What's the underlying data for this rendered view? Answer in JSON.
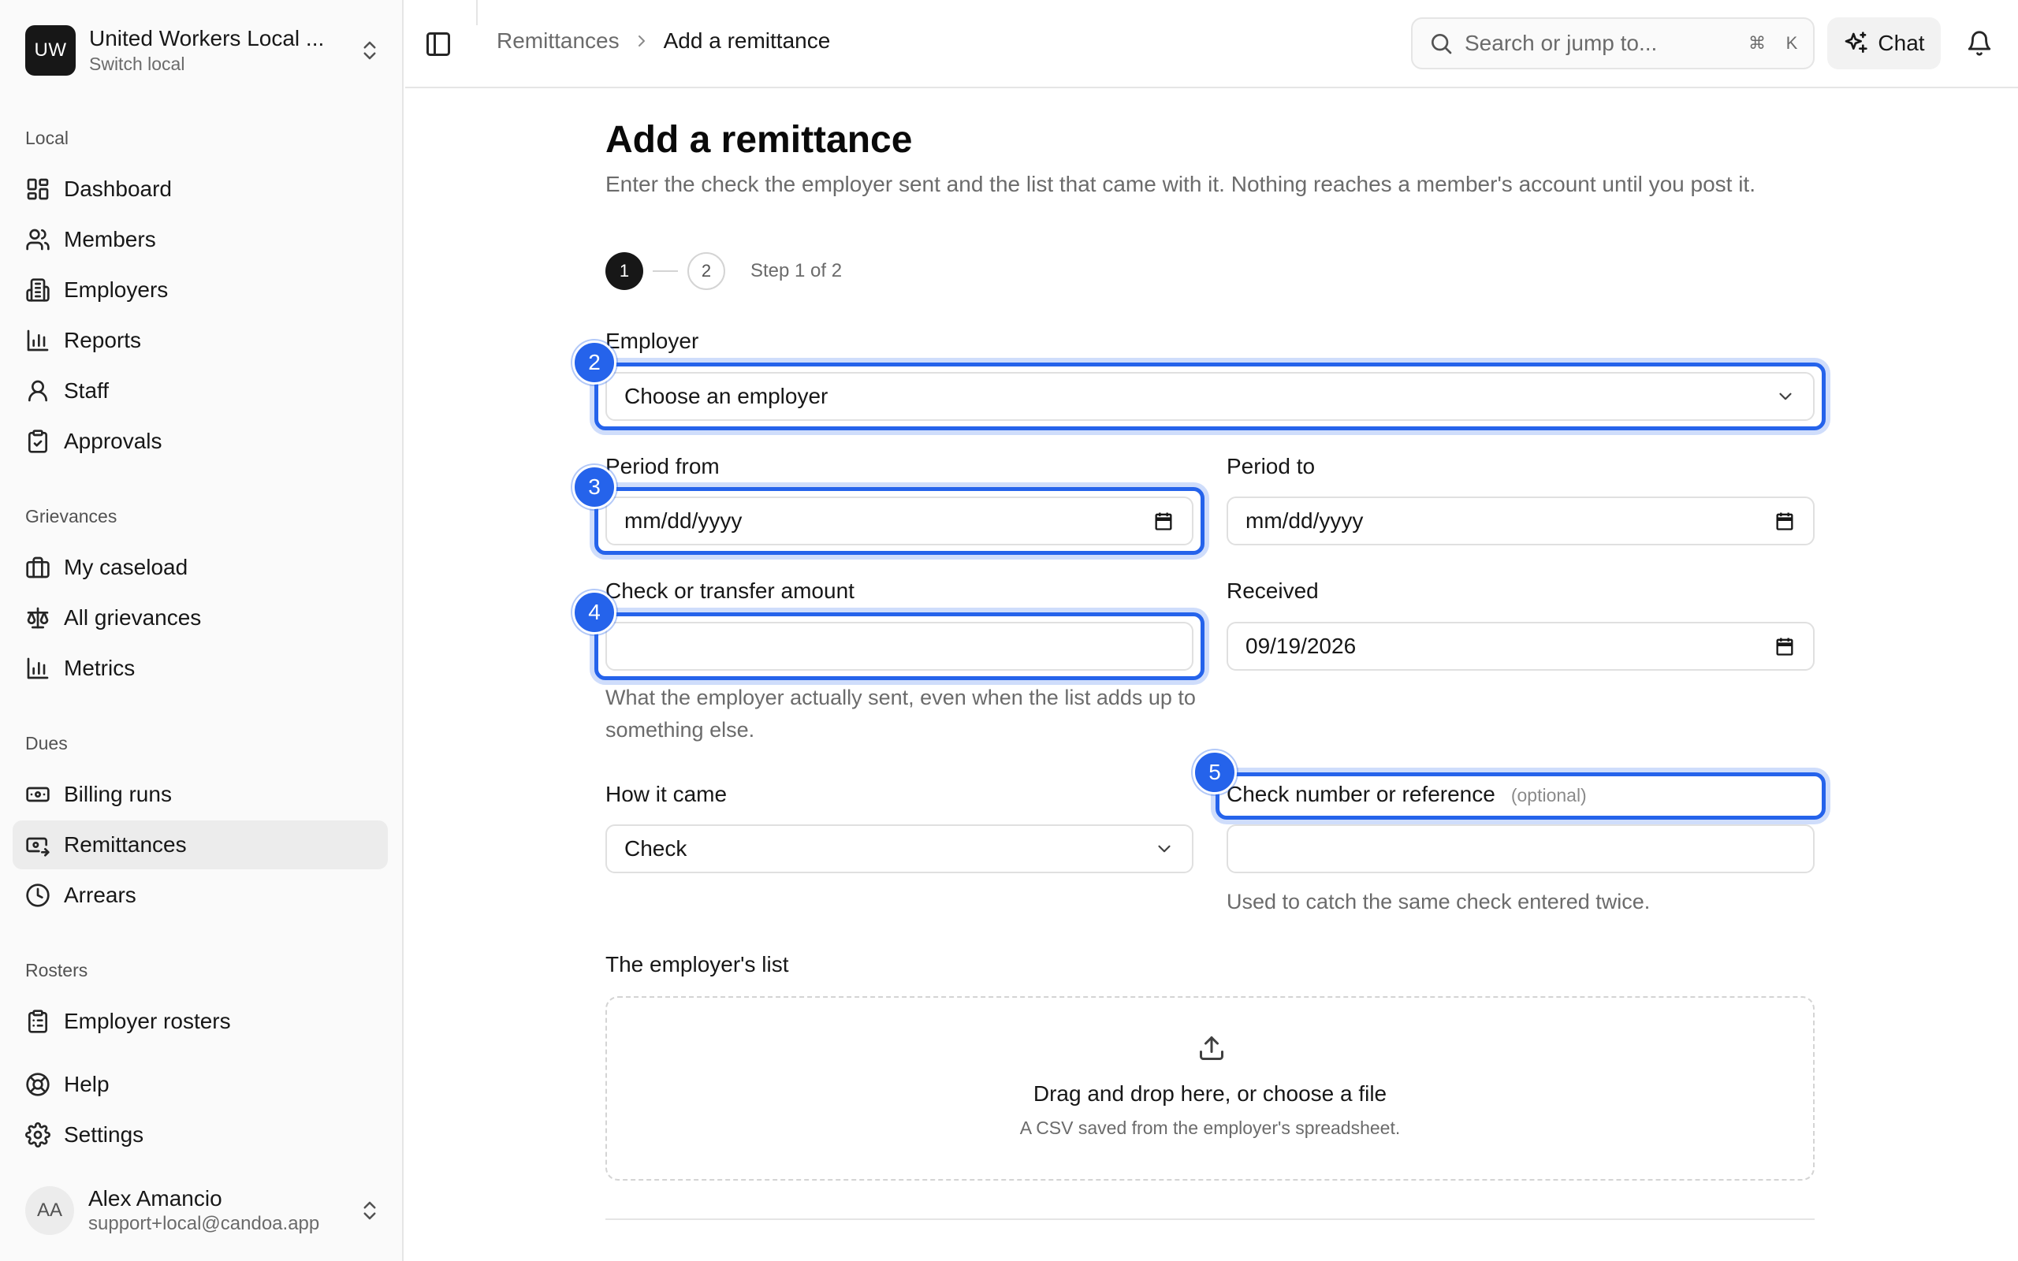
{
  "sidebar": {
    "org": {
      "initials": "UW",
      "name": "United Workers Local ...",
      "switch_label": "Switch local"
    },
    "sections": [
      {
        "label": "Local",
        "items": [
          {
            "label": "Dashboard",
            "icon": "dashboard-icon"
          },
          {
            "label": "Members",
            "icon": "users-icon"
          },
          {
            "label": "Employers",
            "icon": "building-icon"
          },
          {
            "label": "Reports",
            "icon": "bar-chart-icon"
          },
          {
            "label": "Staff",
            "icon": "user-icon"
          },
          {
            "label": "Approvals",
            "icon": "clipboard-check-icon"
          }
        ]
      },
      {
        "label": "Grievances",
        "items": [
          {
            "label": "My caseload",
            "icon": "briefcase-icon"
          },
          {
            "label": "All grievances",
            "icon": "scale-icon"
          },
          {
            "label": "Metrics",
            "icon": "bar-chart-icon"
          }
        ]
      },
      {
        "label": "Dues",
        "items": [
          {
            "label": "Billing runs",
            "icon": "banknote-icon"
          },
          {
            "label": "Remittances",
            "icon": "remittance-icon",
            "active": true
          },
          {
            "label": "Arrears",
            "icon": "clock-icon"
          }
        ]
      },
      {
        "label": "Rosters",
        "items": [
          {
            "label": "Employer rosters",
            "icon": "clipboard-list-icon"
          }
        ]
      }
    ],
    "footer_items": [
      {
        "label": "Help",
        "icon": "life-buoy-icon"
      },
      {
        "label": "Settings",
        "icon": "gear-icon"
      }
    ],
    "user": {
      "initials": "AA",
      "name": "Alex Amancio",
      "email": "support+local@candoa.app"
    }
  },
  "topbar": {
    "breadcrumb": {
      "parent": "Remittances",
      "current": "Add a remittance"
    },
    "search": {
      "placeholder": "Search or jump to...",
      "shortcut_mod": "⌘",
      "shortcut_key": "K"
    },
    "chat_label": "Chat"
  },
  "page": {
    "title": "Add a remittance",
    "description": "Enter the check the employer sent and the list that came with it. Nothing reaches a member's account until you post it.",
    "steps": {
      "step1": "1",
      "step2": "2",
      "status": "Step 1 of 2"
    }
  },
  "form": {
    "employer": {
      "label": "Employer",
      "value": "Choose an employer"
    },
    "period_from": {
      "label": "Period from",
      "value": "mm/dd/yyyy"
    },
    "period_to": {
      "label": "Period to",
      "value": "mm/dd/yyyy"
    },
    "amount": {
      "label": "Check or transfer amount",
      "value": "",
      "hint": "What the employer actually sent, even when the list adds up to something else."
    },
    "received": {
      "label": "Received",
      "value": "09/19/2026"
    },
    "method": {
      "label": "How it came",
      "value": "Check"
    },
    "reference": {
      "label": "Check number or reference",
      "optional": "(optional)",
      "value": "",
      "hint": "Used to catch the same check entered twice."
    },
    "upload": {
      "label": "The employer's list",
      "title": "Drag and drop here, or choose a file",
      "subtitle": "A CSV saved from the employer's spreadsheet."
    }
  },
  "annotations": [
    "2",
    "3",
    "4",
    "5"
  ],
  "colors": {
    "highlight": "#2563eb",
    "primary": "#171717",
    "muted": "#6b6b6b",
    "border": "#e0e0e0"
  }
}
